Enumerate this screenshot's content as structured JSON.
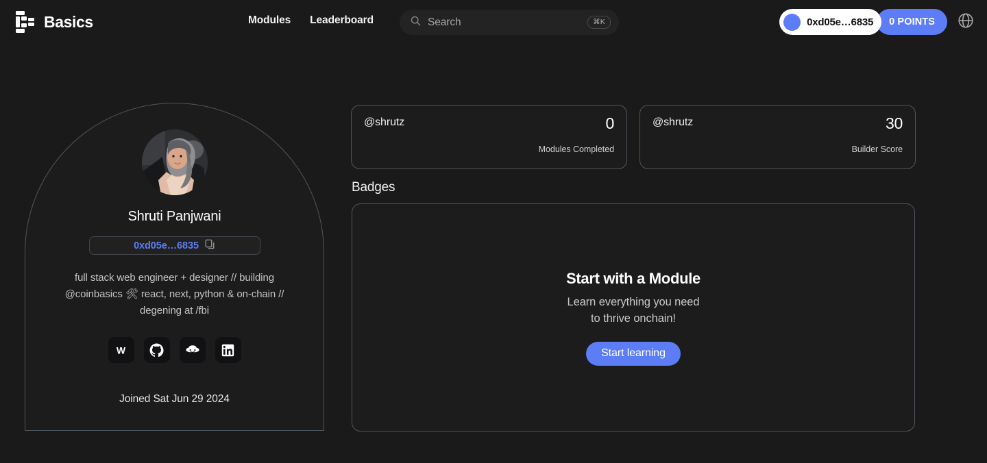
{
  "header": {
    "brand": "Basics",
    "brand_logo_icon": "basics-blocks-logo",
    "nav": [
      {
        "label": "Modules",
        "name": "nav-modules"
      },
      {
        "label": "Leaderboard",
        "name": "nav-leaderboard"
      }
    ],
    "search": {
      "placeholder": "Search",
      "value": "",
      "shortcut": "⌘K",
      "icon": "search-icon"
    },
    "wallet": {
      "address": "0xd05e…6835",
      "avatar_color": "#5d7df7"
    },
    "points": {
      "label": "0 POINTS",
      "color": "#5d7df7"
    },
    "globe_icon": "globe-icon"
  },
  "profile": {
    "name": "Shruti Panjwani",
    "address": "0xd05e…6835",
    "address_color": "#5d7df7",
    "copy_icon": "copy-icon",
    "bio": "full stack web engineer + designer // building @coinbasics 🛠 react, next, python & on-chain // degening at /fbi",
    "joined": "Joined Sat Jun 29 2024",
    "socials": [
      {
        "name": "social-warpcast",
        "icon": "w-icon",
        "label": "W"
      },
      {
        "name": "social-github",
        "icon": "github-icon",
        "label": "GitHub"
      },
      {
        "name": "social-farcaster",
        "icon": "cloud-face-icon",
        "label": "Farcaster"
      },
      {
        "name": "social-linkedin",
        "icon": "linkedin-icon",
        "label": "LinkedIn"
      }
    ]
  },
  "stats": [
    {
      "handle": "@shrutz",
      "value": "0",
      "label": "Modules Completed"
    },
    {
      "handle": "@shrutz",
      "value": "30",
      "label": "Builder Score"
    }
  ],
  "badges": {
    "title": "Badges",
    "empty_title": "Start with a Module",
    "empty_line1": "Learn everything you need",
    "empty_line2": "to thrive onchain!",
    "cta": "Start learning"
  },
  "colors": {
    "background": "#1a1a1a",
    "card": "#1c1c1c",
    "border": "#50565e",
    "accent": "#5d7df7",
    "text": "#ffffff",
    "muted": "#c4c4c4"
  }
}
